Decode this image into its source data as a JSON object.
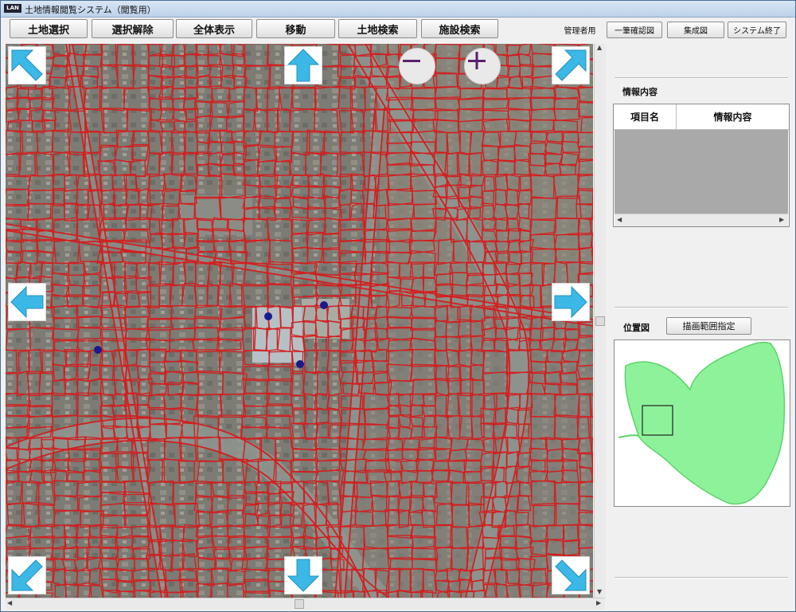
{
  "window": {
    "title": "土地情報閲覧システム（閲覧用）",
    "icon_text": "LAN"
  },
  "toolbar": {
    "buttons": [
      "土地選択",
      "選択解除",
      "全体表示",
      "移動",
      "土地検索",
      "施設検索"
    ]
  },
  "top_right": {
    "admin_label": "管理者用",
    "buttons": [
      "一筆確認図",
      "集成図",
      "システム終了"
    ]
  },
  "map": {
    "zoom_out_symbol": "−",
    "zoom_in_symbol": "+",
    "arrows": [
      "arrow-up-left-icon",
      "arrow-up-icon",
      "arrow-up-right-icon",
      "arrow-left-icon",
      "arrow-right-icon",
      "arrow-down-left-icon",
      "arrow-down-icon",
      "arrow-down-right-icon"
    ],
    "colors": {
      "parcel_line": "#d21f1f",
      "aerial_base": "#7f7f78",
      "marker": "#1a1a8c",
      "arrow": "#3cb8e6"
    }
  },
  "info_panel": {
    "section_title": "情報内容",
    "columns": [
      "項目名",
      "情報内容"
    ]
  },
  "location_panel": {
    "section_title": "位置図",
    "button_label": "描画範囲指定",
    "colors": {
      "area": "#8ef29a",
      "border": "#5dd36a",
      "focus_box": "#222222"
    }
  }
}
